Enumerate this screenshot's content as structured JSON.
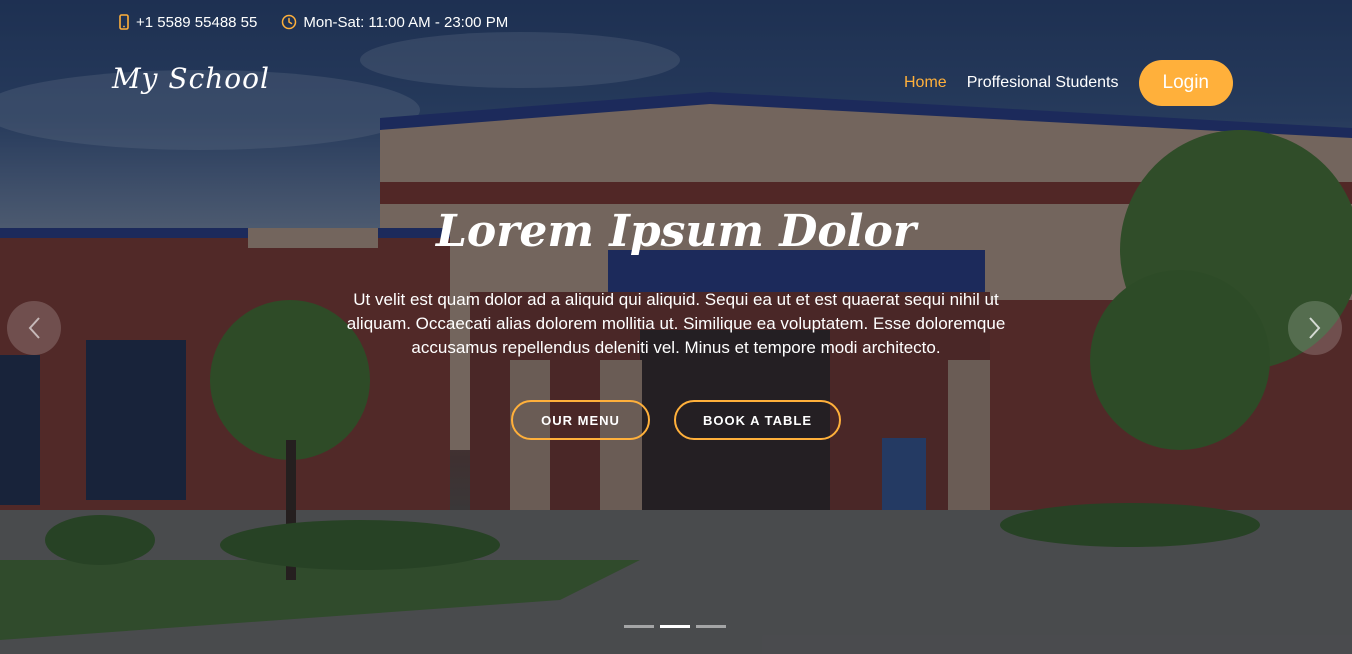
{
  "topbar": {
    "phone": "+1 5589 55488 55",
    "hours": "Mon-Sat: 11:00 AM - 23:00 PM",
    "phone_icon": "phone-icon",
    "clock_icon": "clock-icon"
  },
  "header": {
    "logo": "My School",
    "nav": [
      {
        "label": "Home",
        "active": true
      },
      {
        "label": "Proffesional Students",
        "active": false
      }
    ],
    "login_label": "Login"
  },
  "hero": {
    "title": "Lorem Ipsum Dolor",
    "description": "Ut velit est quam dolor ad a aliquid qui aliquid. Sequi ea ut et est quaerat sequi nihil ut aliquam. Occaecati alias dolorem mollitia ut. Similique ea voluptatem. Esse doloremque accusamus repellendus deleniti vel. Minus et tempore modi architecto.",
    "button_menu": "OUR MENU",
    "button_book": "BOOK A TABLE",
    "slides": 3,
    "active_slide": 2,
    "background_image": "school-building-photo"
  },
  "colors": {
    "accent": "#ffb03b",
    "text": "#ffffff"
  }
}
